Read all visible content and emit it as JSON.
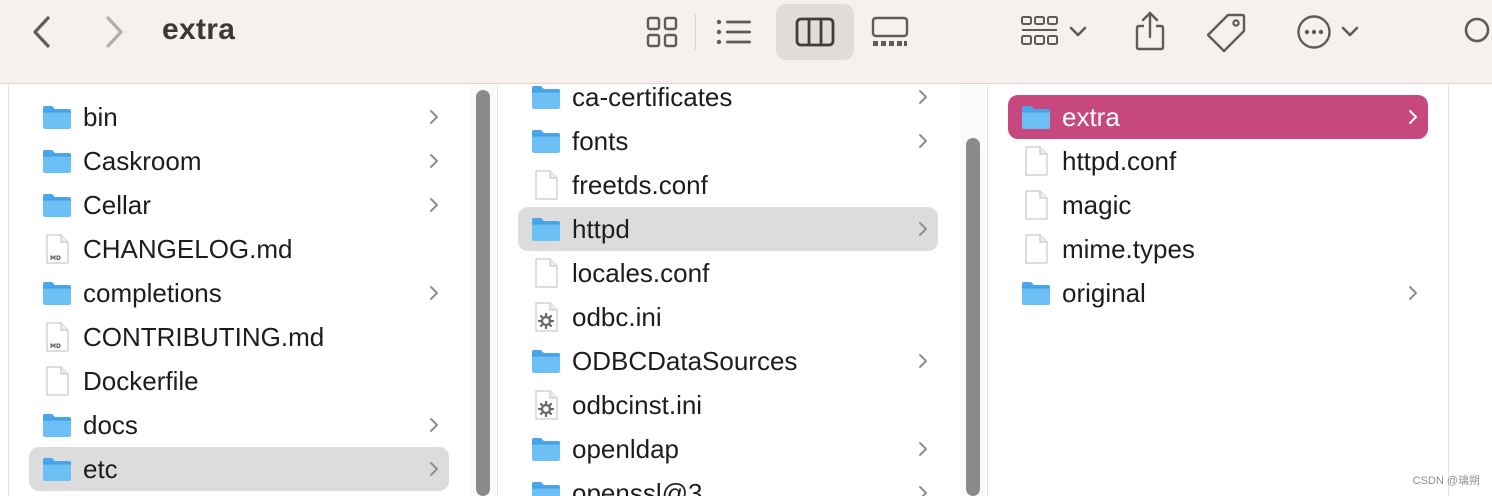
{
  "window": {
    "title": "extra"
  },
  "toolbar": {
    "back_icon": "chevron-left-icon",
    "forward_icon": "chevron-right-icon",
    "view_modes": [
      "icons-view-icon",
      "list-view-icon",
      "columns-view-icon",
      "gallery-view-icon"
    ],
    "active_view": "columns",
    "group_icon": "group-by-icon",
    "share_icon": "share-icon",
    "tag_icon": "tag-icon",
    "more_icon": "ellipsis-icon",
    "search_icon": "search-icon"
  },
  "columns": [
    {
      "items": [
        {
          "name": "bin",
          "type": "folder",
          "chevron": true
        },
        {
          "name": "Caskroom",
          "type": "folder",
          "chevron": true
        },
        {
          "name": "Cellar",
          "type": "folder",
          "chevron": true
        },
        {
          "name": "CHANGELOG.md",
          "type": "md",
          "chevron": false
        },
        {
          "name": "completions",
          "type": "folder",
          "chevron": true
        },
        {
          "name": "CONTRIBUTING.md",
          "type": "md",
          "chevron": false
        },
        {
          "name": "Dockerfile",
          "type": "file",
          "chevron": false
        },
        {
          "name": "docs",
          "type": "folder",
          "chevron": true
        },
        {
          "name": "etc",
          "type": "folder",
          "chevron": true,
          "selected": "gray"
        }
      ]
    },
    {
      "items": [
        {
          "name": "ca-certificates",
          "type": "folder",
          "chevron": true
        },
        {
          "name": "fonts",
          "type": "folder",
          "chevron": true
        },
        {
          "name": "freetds.conf",
          "type": "file",
          "chevron": false
        },
        {
          "name": "httpd",
          "type": "folder",
          "chevron": true,
          "selected": "gray"
        },
        {
          "name": "locales.conf",
          "type": "file",
          "chevron": false
        },
        {
          "name": "odbc.ini",
          "type": "config",
          "chevron": false
        },
        {
          "name": "ODBCDataSources",
          "type": "folder",
          "chevron": true
        },
        {
          "name": "odbcinst.ini",
          "type": "config",
          "chevron": false
        },
        {
          "name": "openldap",
          "type": "folder",
          "chevron": true
        },
        {
          "name": "openssl@3",
          "type": "folder",
          "chevron": true
        }
      ]
    },
    {
      "items": [
        {
          "name": "extra",
          "type": "folder",
          "chevron": true,
          "selected": "pink"
        },
        {
          "name": "httpd.conf",
          "type": "file",
          "chevron": false
        },
        {
          "name": "magic",
          "type": "file",
          "chevron": false
        },
        {
          "name": "mime.types",
          "type": "file",
          "chevron": false
        },
        {
          "name": "original",
          "type": "folder",
          "chevron": true
        }
      ]
    }
  ],
  "colors": {
    "selection_active": "#c7487f",
    "selection_inactive": "#dcdcdc",
    "folder": "#5bb3f0",
    "toolbar_bg": "#f6f1ee"
  },
  "watermark": "CSDN @璃朔"
}
